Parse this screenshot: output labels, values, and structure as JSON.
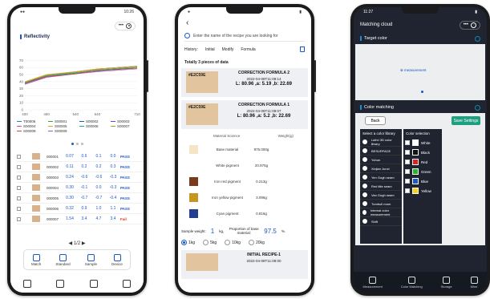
{
  "phone1": {
    "status_time": "10:26",
    "chart_title": "Reflectivity",
    "chart_data": {
      "type": "line",
      "title": "Reflectivity",
      "x": [
        400,
        460,
        540,
        600,
        710
      ],
      "x_ticks": [
        "400",
        "460",
        "540",
        "640",
        "710"
      ],
      "y_ticks": [
        "70",
        "60",
        "50",
        "40",
        "30",
        "20",
        "10",
        "0"
      ],
      "ylim": [
        0,
        75
      ],
      "series": [
        {
          "name": "T00006",
          "values": [
            38,
            48,
            52,
            56,
            60
          ]
        },
        {
          "name": "S00002",
          "values": [
            39,
            49,
            53,
            57,
            61
          ]
        },
        {
          "name": "S00004",
          "values": [
            37,
            47,
            52,
            55,
            59
          ]
        },
        {
          "name": "S00001",
          "values": [
            38,
            49,
            54,
            58,
            62
          ]
        },
        {
          "name": "S00006",
          "values": [
            36,
            46,
            51,
            54,
            58
          ]
        },
        {
          "name": "S00005",
          "values": [
            40,
            50,
            54,
            58,
            62
          ]
        },
        {
          "name": "S00007",
          "values": [
            37,
            48,
            52,
            55,
            60
          ]
        },
        {
          "name": "S00009",
          "values": [
            39,
            49,
            53,
            57,
            60
          ]
        },
        {
          "name": "S00003",
          "values": [
            38,
            47,
            51,
            56,
            59
          ]
        }
      ]
    },
    "legend": [
      {
        "name": "T00006",
        "color": "#2a7ac8"
      },
      {
        "name": "S00001",
        "color": "#31a24c"
      },
      {
        "name": "S00002",
        "color": "#1a57c8"
      },
      {
        "name": "S00003",
        "color": "#7a3ec8"
      },
      {
        "name": "S00004",
        "color": "#d64aa0"
      },
      {
        "name": "S00005",
        "color": "#e3a214"
      },
      {
        "name": "S00006",
        "color": "#18a6a6"
      },
      {
        "name": "S00007",
        "color": "#8fb21c"
      },
      {
        "name": "S00008",
        "color": "#c8463e"
      },
      {
        "name": "S00009",
        "color": "#6c6cd6"
      }
    ],
    "rows": [
      {
        "id": "000001",
        "v": [
          "0.07",
          "0.6",
          "0.1",
          "0.0"
        ],
        "status": "PASS"
      },
      {
        "id": "000002",
        "v": [
          "0.11",
          "0.2",
          "0.2",
          "0.3"
        ],
        "status": "PASS"
      },
      {
        "id": "000003",
        "v": [
          "0.24",
          "-0.6",
          "-0.6",
          "-0.3"
        ],
        "status": "PASS"
      },
      {
        "id": "000004",
        "v": [
          "0.30",
          "-0.1",
          "0.0",
          "-0.3"
        ],
        "status": "PASS"
      },
      {
        "id": "000005",
        "v": [
          "0.30",
          "-0.7",
          "-0.7",
          "-0.4"
        ],
        "status": "PASS"
      },
      {
        "id": "000006",
        "v": [
          "0.32",
          "0.9",
          "1.0",
          "1.1"
        ],
        "status": "PASS"
      },
      {
        "id": "000007",
        "v": [
          "1.54",
          "3.4",
          "4.7",
          "3.4"
        ],
        "status": "Fail"
      }
    ],
    "pager": "◀ 1/2 ▶",
    "nav": [
      "Match",
      "Standard",
      "Sample",
      "Device"
    ],
    "bottom": [
      "",
      "",
      "",
      ""
    ]
  },
  "phone2": {
    "search_placeholder": "Enter the name of the recipe you are looking for",
    "history_label": "History:",
    "history_tabs": [
      "Initial",
      "Modify",
      "Formula"
    ],
    "total": "Totally 3 pieces of data",
    "cards": [
      {
        "tag": "#E2C59E",
        "title": "CORRECTION FORMULA 2",
        "date": "2022-04-08T11:08:14",
        "lab": "L: 80.96 ,a: 5.19 ,b: 22.69"
      },
      {
        "tag": "#E2C59E",
        "title": "CORRECTION FORMULA 1",
        "date": "2022-04-08T11:08:07",
        "lab": "L: 80.96 ,a: 5.2 ,b: 22.69"
      }
    ],
    "detail_headers": [
      "Material Science",
      "Weight(g)"
    ],
    "materials": [
      {
        "name": "Base material",
        "weight": "975.000g",
        "color": "#f6e4c6"
      },
      {
        "name": "White pigment",
        "weight": "20.875g",
        "color": "#ffffff"
      },
      {
        "name": "Iron red pigment",
        "weight": "0.213g",
        "color": "#7a3b1d"
      },
      {
        "name": "Iron yellow pigment",
        "weight": "3.096g",
        "color": "#c7961e"
      },
      {
        "name": "Cyan pigment",
        "weight": "0.816g",
        "color": "#26408f"
      }
    ],
    "sample_weight_label": "Sample weight:",
    "sample_weight": "1",
    "sample_unit": "kg,",
    "proportion_label": "Proportion of base material:",
    "proportion_value": "97.5",
    "proportion_unit": "%.",
    "weight_options": [
      "1kg",
      "5kg",
      "10kg",
      "20kg"
    ],
    "bottom_card": {
      "title": "INITIAL RECIPE-1",
      "date": "2022-04-08T11:08:00"
    }
  },
  "phone3": {
    "status_time": "11:27",
    "title": "Matching cloud",
    "target_label": "Target color",
    "measurement": "measurement",
    "color_matching": "Color matching",
    "back": "Back",
    "save": "Save Settings",
    "library_header": "Select a color library",
    "libraries": [
      "Luthri 3D color library",
      "BESURFACE",
      "Yohon",
      "Xinjian Junxi",
      "Yen Gogh seam",
      "Red title seam",
      "Van Gogh seam",
      "Tumbull room",
      "Internal color measurement",
      "Shift"
    ],
    "selection_header": "Color selection",
    "colors": [
      {
        "name": "White",
        "hex": "#ffffff"
      },
      {
        "name": "Black",
        "hex": "#111111"
      },
      {
        "name": "Red",
        "hex": "#e02020"
      },
      {
        "name": "Green",
        "hex": "#2bb52b"
      },
      {
        "name": "Blue",
        "hex": "#1a57c8"
      },
      {
        "name": "Yellow",
        "hex": "#f2d21a"
      }
    ],
    "nav": [
      "Measurement",
      "Color Matching",
      "Storage",
      "Mine"
    ]
  }
}
